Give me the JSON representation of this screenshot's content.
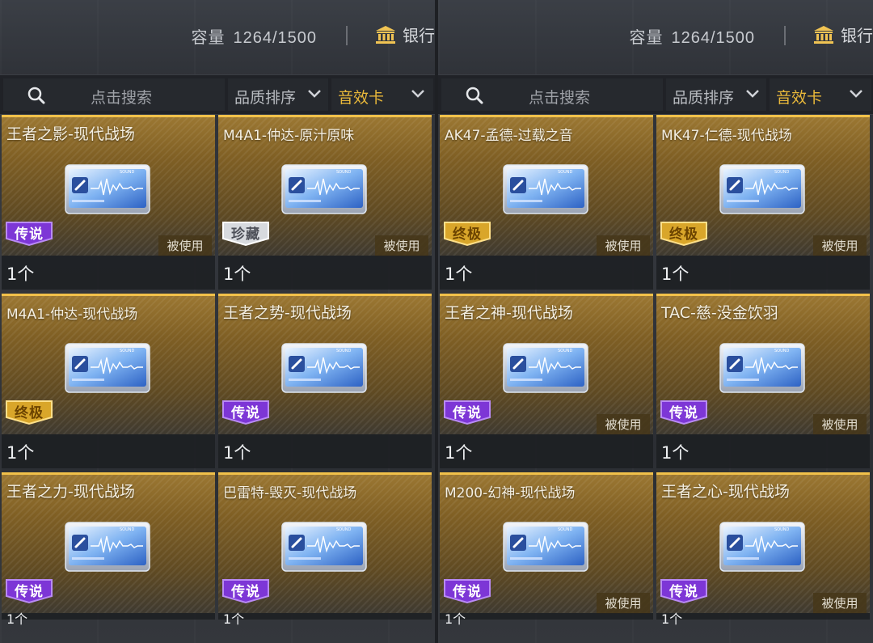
{
  "panels": [
    {
      "capacity_label": "容量",
      "capacity_value": "1264/1500",
      "bank_label": "银行",
      "search_placeholder": "点击搜索",
      "sort_label": "品质排序",
      "filter_label": "音效卡",
      "cards": [
        {
          "title": "王者之影-现代战场",
          "rarity": "传说",
          "rarity_color": "#8a3ee0",
          "used": "被使用",
          "count": "1个"
        },
        {
          "title": "M4A1-仲达-原汁原味",
          "rarity": "珍藏",
          "rarity_color": "#c9ccd2",
          "used": "被使用",
          "count": "1个"
        },
        {
          "title": "M4A1-仲达-现代战场",
          "rarity": "终极",
          "rarity_color": "#e9b83a",
          "used": "",
          "count": "1个"
        },
        {
          "title": "王者之势-现代战场",
          "rarity": "传说",
          "rarity_color": "#8a3ee0",
          "used": "",
          "count": "1个"
        },
        {
          "title": "王者之力-现代战场",
          "rarity": "传说",
          "rarity_color": "#8a3ee0",
          "used": "",
          "count": "1个"
        },
        {
          "title": "巴雷特-毁灭-现代战场",
          "rarity": "传说",
          "rarity_color": "#8a3ee0",
          "used": "",
          "count": "1个"
        }
      ]
    },
    {
      "capacity_label": "容量",
      "capacity_value": "1264/1500",
      "bank_label": "银行",
      "search_placeholder": "点击搜索",
      "sort_label": "品质排序",
      "filter_label": "音效卡",
      "cards": [
        {
          "title": "AK47-孟德-过载之音",
          "rarity": "终极",
          "rarity_color": "#e9b83a",
          "used": "被使用",
          "count": "1个"
        },
        {
          "title": "MK47-仁德-现代战场",
          "rarity": "终极",
          "rarity_color": "#e9b83a",
          "used": "被使用",
          "count": "1个"
        },
        {
          "title": "王者之神-现代战场",
          "rarity": "传说",
          "rarity_color": "#8a3ee0",
          "used": "被使用",
          "count": "1个"
        },
        {
          "title": "TAC-慈-没金饮羽",
          "rarity": "传说",
          "rarity_color": "#8a3ee0",
          "used": "被使用",
          "count": "1个"
        },
        {
          "title": "M200-幻神-现代战场",
          "rarity": "传说",
          "rarity_color": "#8a3ee0",
          "used": "被使用",
          "count": "1个"
        },
        {
          "title": "王者之心-现代战场",
          "rarity": "传说",
          "rarity_color": "#8a3ee0",
          "used": "被使用",
          "count": "1个"
        }
      ]
    }
  ],
  "icons": {
    "search": "search-icon",
    "bank": "bank-icon",
    "chevron": "chevron-down-icon",
    "sound_card": "sound-card-icon"
  },
  "colors": {
    "accent_gold": "#e9b83a",
    "legend_purple": "#8a3ee0",
    "card_border": "#f2c14a"
  }
}
